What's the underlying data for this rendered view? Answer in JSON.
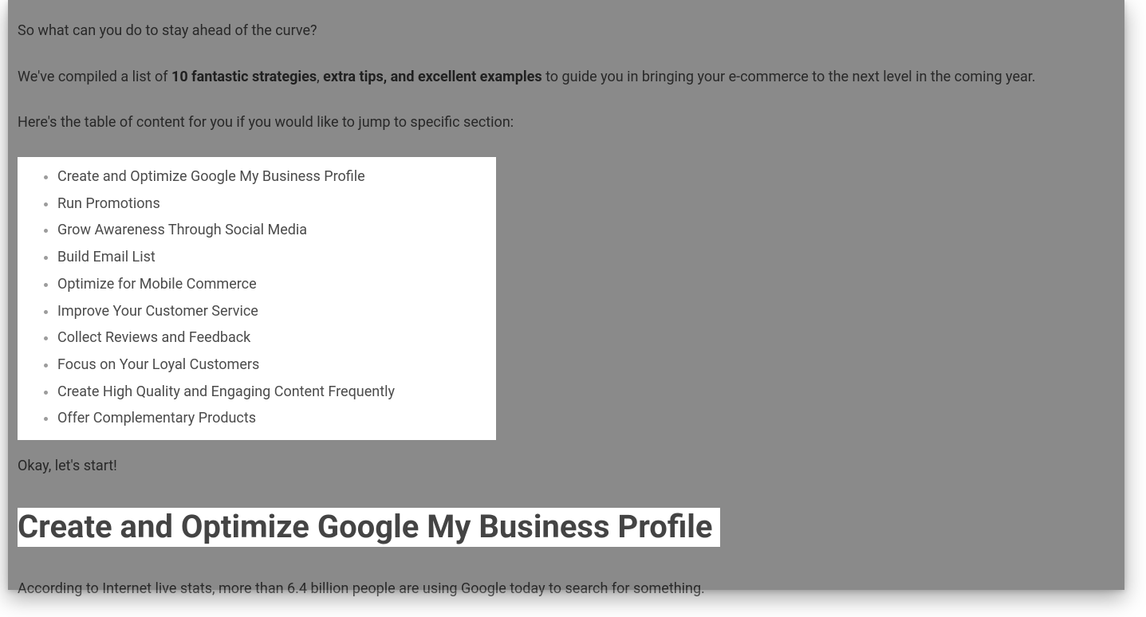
{
  "intro": {
    "p1": "So what can you do to stay ahead of the curve?",
    "p2_lead": "We've compiled a list of ",
    "p2_bold": "10 fantastic strategies",
    "p2_comma": ", ",
    "p2_bold2": "extra tips, and excellent examples",
    "p2_tail": " to guide you in bringing your e-commerce to the next level in the coming year.",
    "p3": "Here's the table of content for you if you would like to jump to specific section:"
  },
  "toc": {
    "items": [
      "Create and Optimize Google My Business Profile",
      "Run Promotions",
      "Grow Awareness Through Social Media",
      "Build Email List",
      "Optimize for Mobile Commerce",
      "Improve Your Customer Service",
      "Collect Reviews and Feedback",
      "Focus on Your Loyal Customers",
      "Create High Quality and Engaging Content Frequently",
      "Offer Complementary Products"
    ]
  },
  "after_toc": "Okay, let's start!",
  "section": {
    "heading": "Create and Optimize Google My Business Profile",
    "body_lead": "According to ",
    "body_link": "Internet live stats",
    "body_tail": ", more than 6.4 billion people are using Google today to search for something."
  }
}
